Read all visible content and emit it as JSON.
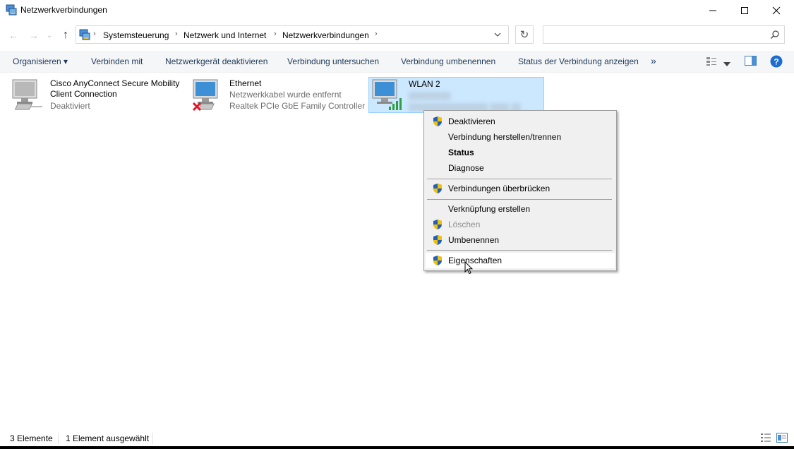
{
  "window": {
    "title": "Netzwerkverbindungen",
    "minimize_glyph": "—",
    "maximize_glyph": "☐",
    "close_glyph": "✕"
  },
  "navigation": {
    "back_glyph": "←",
    "forward_glyph": "→",
    "recent_glyph": "⌄",
    "up_glyph": "↑"
  },
  "address": {
    "breadcrumbs": [
      "Systemsteuerung",
      "Netzwerk und Internet",
      "Netzwerkverbindungen"
    ],
    "separator": "›",
    "refresh_glyph": "↻",
    "search_placeholder": ""
  },
  "toolbar": {
    "items": [
      "Organisieren ▾",
      "Verbinden mit",
      "Netzwerkgerät deaktivieren",
      "Verbindung untersuchen",
      "Verbindung umbenennen",
      "Status der Verbindung anzeigen"
    ],
    "overflow": "»"
  },
  "connections": [
    {
      "name_line1": "Cisco AnyConnect Secure Mobility",
      "name_line2": "Client Connection",
      "status": "Deaktiviert",
      "icon": "network-adapter-icon"
    },
    {
      "name_line1": "Ethernet",
      "status": "Netzwerkkabel wurde entfernt",
      "device": "Realtek PCIe GbE Family Controller",
      "icon": "network-adapter-icon",
      "badge": "disconnected-x-icon"
    },
    {
      "name_line1": "WLAN 2",
      "status": "▯▯▯▯▯▯▯▯▯",
      "device": "▯▯▯▯▯▯▯▯▯▯▯▯▯▯▯▯▯ ▯▯▯▯ ▯▯",
      "icon": "wifi-adapter-icon",
      "selected": true
    }
  ],
  "context_menu": {
    "items": [
      {
        "label": "Deaktivieren",
        "shield": true
      },
      {
        "label": "Verbindung herstellen/trennen",
        "shield": false
      },
      {
        "label": "Status",
        "shield": false,
        "bold": true
      },
      {
        "label": "Diagnose",
        "shield": false
      },
      {
        "label": "Verbindungen überbrücken",
        "shield": true
      },
      {
        "label": "Verknüpfung erstellen",
        "shield": false
      },
      {
        "label": "Löschen",
        "shield": true,
        "disabled": true
      },
      {
        "label": "Umbenennen",
        "shield": true
      },
      {
        "label": "Eigenschaften",
        "shield": true,
        "hover": true
      }
    ]
  },
  "statusbar": {
    "count": "3 Elemente",
    "selection": "1 Element ausgewählt"
  },
  "colors": {
    "selection_bg": "#cce8ff",
    "selection_border": "#99d1ff",
    "command_text": "#1e395b",
    "help_blue": "#1c6dd0",
    "disconnect_red": "#e81123",
    "signal_green": "#2f9e44"
  }
}
